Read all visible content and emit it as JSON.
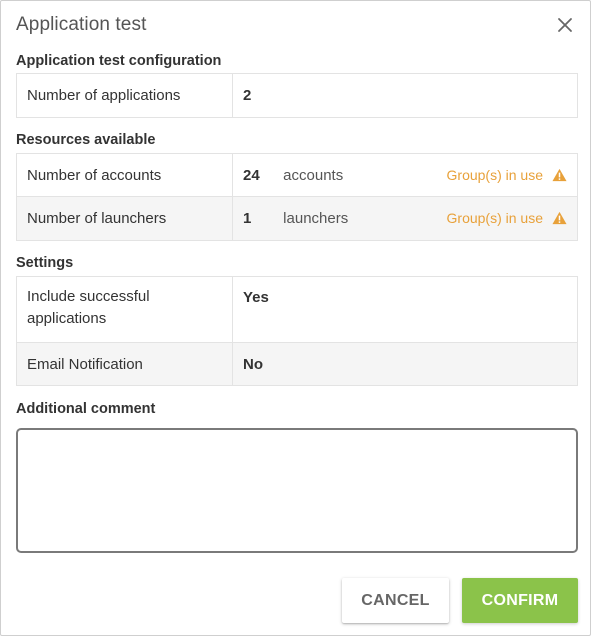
{
  "dialog": {
    "title": "Application test",
    "close_icon": "close-icon"
  },
  "config": {
    "heading": "Application test configuration",
    "rows": [
      {
        "label": "Number of applications",
        "value": "2"
      }
    ]
  },
  "resources": {
    "heading": "Resources available",
    "rows": [
      {
        "label": "Number of accounts",
        "value": "24",
        "unit": "accounts",
        "status": "Group(s) in use",
        "status_icon": "warning-icon"
      },
      {
        "label": "Number of launchers",
        "value": "1",
        "unit": "launchers",
        "status": "Group(s) in use",
        "status_icon": "warning-icon"
      }
    ]
  },
  "settings": {
    "heading": "Settings",
    "rows": [
      {
        "label": "Include successful applications",
        "value": "Yes"
      },
      {
        "label": "Email Notification",
        "value": "No"
      }
    ]
  },
  "comment": {
    "heading": "Additional comment",
    "value": "",
    "placeholder": ""
  },
  "buttons": {
    "cancel": "CANCEL",
    "confirm": "CONFIRM"
  },
  "colors": {
    "accent_green": "#8bc34a",
    "warning_orange": "#e8a13a"
  }
}
